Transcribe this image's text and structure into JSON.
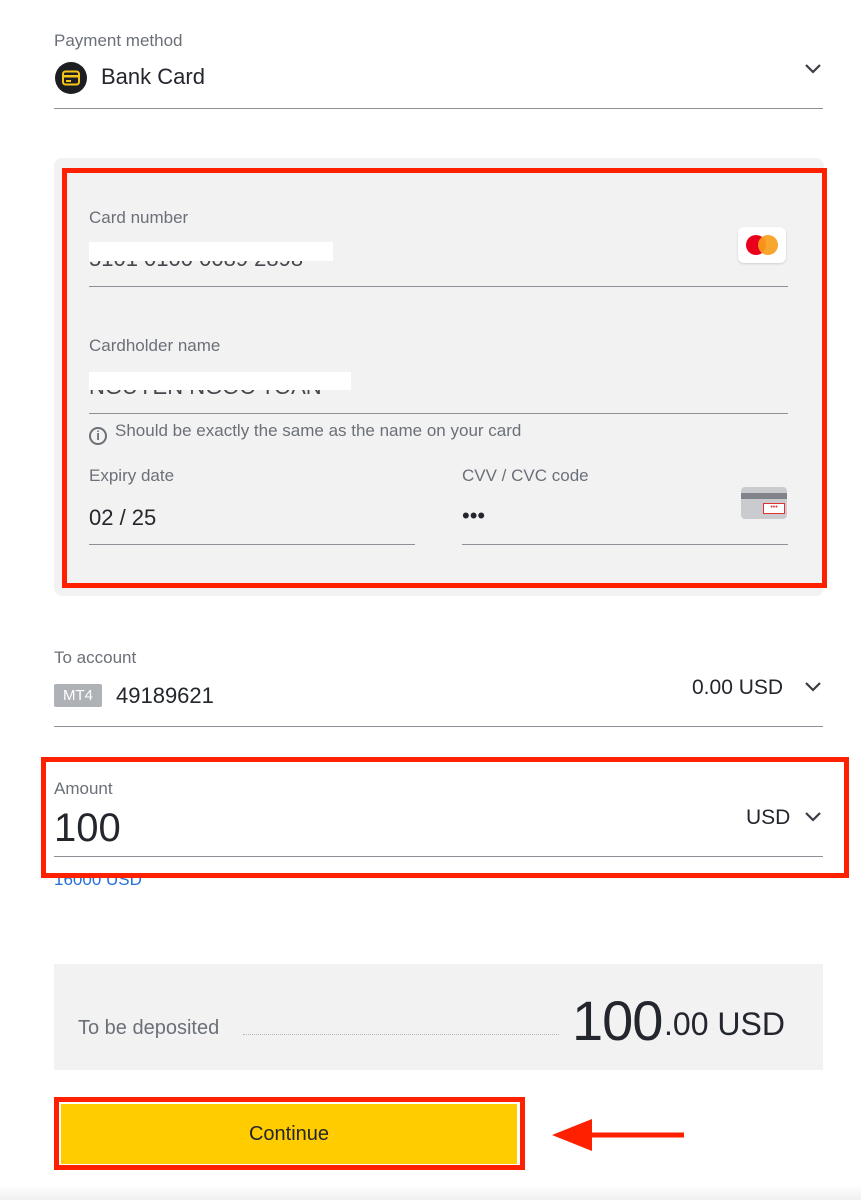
{
  "payment_method": {
    "label": "Payment method",
    "value": "Bank Card",
    "icon": "bank-card-icon"
  },
  "card": {
    "number_label": "Card number",
    "number_value": "5101 0100 0089 2898",
    "brand_icon": "mastercard-icon",
    "holder_label": "Cardholder name",
    "holder_value": "NGUYEN NGOC TOAN",
    "holder_hint": "Should be exactly the same as the name on your card",
    "expiry_label": "Expiry date",
    "expiry_value": "02 / 25",
    "cvv_label": "CVV / CVC code",
    "cvv_value": "•••",
    "cvv_icon": "cvv-card-icon"
  },
  "account": {
    "label": "To account",
    "platform": "MT4",
    "number": "49189621",
    "balance": "0.00 USD"
  },
  "amount": {
    "label": "Amount",
    "value": "100",
    "currency": "USD",
    "limit_text": "16000 USD"
  },
  "summary": {
    "label": "To be deposited",
    "whole": "100",
    "fraction_currency": ".00 USD"
  },
  "continue_label": "Continue",
  "colors": {
    "accent_yellow": "#ffcc00",
    "highlight_red": "#ff2000",
    "link_blue": "#2470d8"
  }
}
